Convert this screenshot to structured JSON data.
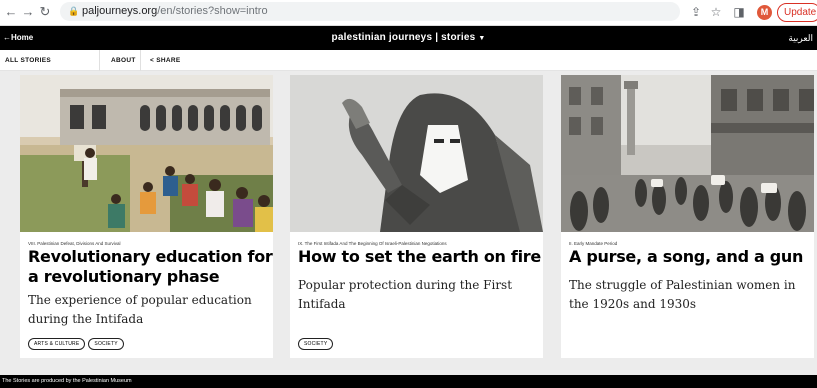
{
  "browser": {
    "url_host": "paljourneys.org",
    "url_path": "/en/stories?show=intro",
    "avatar_letter": "M",
    "update_label": "Update"
  },
  "site": {
    "home_label": "Home",
    "title": "palestinian journeys | stories",
    "arabic_label": "العربية"
  },
  "subnav": {
    "all_stories": "ALL STORIES",
    "about": "ABOUT",
    "share": "SHARE"
  },
  "cards": [
    {
      "period": "VIII. Palestinian Defeat, Divisions And Survival",
      "title": "Revolutionary education for a revolutionary phase",
      "subtitle": "The experience of popular education during the Intifada",
      "tags": [
        "ARTS & CULTURE",
        "SOCIETY"
      ]
    },
    {
      "period": "IX. The First Intifada And The Beginning Of Israeli-Palestinian Negotiations",
      "title": "How to set the earth on fire",
      "subtitle": "Popular protection during the First Intifada",
      "tags": [
        "SOCIETY"
      ]
    },
    {
      "period": "II. Early Mandate Period",
      "title": "A purse, a song, and a gun",
      "subtitle": "The struggle of Palestinian women in the 1920s and 1930s",
      "tags": []
    }
  ],
  "footer": {
    "text": "The Stories are produced by the Palestinian Museum"
  },
  "colors": {
    "site_bar": "#000000",
    "update_accent": "#d93025",
    "avatar": "#e0583a"
  }
}
